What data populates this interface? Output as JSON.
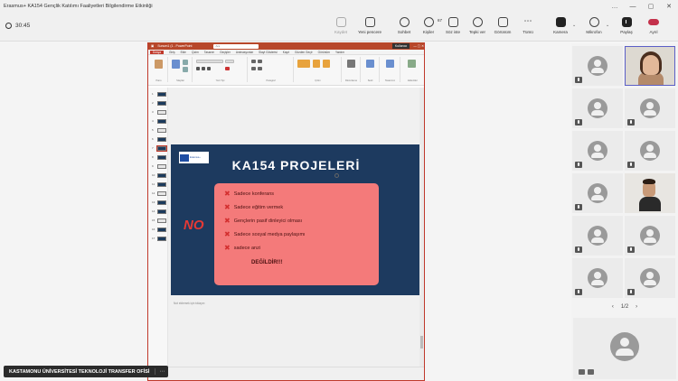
{
  "window": {
    "title": "Erasmus+ KA154 Gençlik Katılımı Faaliyetleri Bilgilendirme Etkinliği",
    "controls": [
      "…",
      "—",
      "▢",
      "✕"
    ]
  },
  "toolbar": {
    "timer": "30:45",
    "buttons": [
      {
        "label": "Kaydet",
        "icon": "save-icon",
        "disabled": true
      },
      {
        "label": "Yeni pencere",
        "icon": "new-window-icon",
        "disabled": false
      },
      {
        "label": "Sohbet",
        "icon": "chat-icon",
        "disabled": false
      },
      {
        "label": "Kişiler",
        "icon": "people-icon",
        "disabled": false,
        "count": "67"
      },
      {
        "label": "Söz iste",
        "icon": "raise-hand-icon",
        "disabled": false
      },
      {
        "label": "Tepki ver",
        "icon": "reaction-icon",
        "disabled": false
      },
      {
        "label": "Görünüm",
        "icon": "view-icon",
        "disabled": false
      },
      {
        "label": "Tümü",
        "icon": "more-icon",
        "disabled": false
      },
      {
        "label": "Kamera",
        "icon": "camera-icon",
        "disabled": false
      },
      {
        "label": "Mikrofon",
        "icon": "microphone-icon",
        "disabled": false
      },
      {
        "label": "Paylaş",
        "icon": "share-icon",
        "disabled": false
      }
    ],
    "leave_label": "Ayrıl"
  },
  "ppt": {
    "title": "Sunum1 (1 - PowerPoint",
    "search_placeholder": "Ara",
    "user": "Kullanıcı",
    "menu": [
      "Dosya",
      "Giriş",
      "Ekle",
      "Çizim",
      "Tasarım",
      "Geçişler",
      "Animasyonlar",
      "Slayt Gösterisi",
      "Kayıt",
      "Gözden Geçir",
      "Görünüm",
      "Yardım"
    ],
    "ribbon_groups": [
      "Pano",
      "Slaytlar",
      "Yazı Tipi",
      "Paragraf",
      "Çizim",
      "Düzenleme",
      "Sesli",
      "Tasarımcı",
      "Eklentiler"
    ],
    "slide_numbers": [
      "1",
      "2",
      "3",
      "4",
      "5",
      "6",
      "7",
      "8",
      "9",
      "10",
      "11",
      "12",
      "13",
      "14",
      "15",
      "16",
      "17"
    ],
    "notes_placeholder": "Not eklemek için tıklayın",
    "slide": {
      "logo_text": "Erasmus+",
      "title": "KA154 PROJELERİ",
      "side_text": "NO",
      "bullets": [
        "Sadece konferans",
        "Sadece eğitim vermek",
        "Gençlerin pasif dinleyici olması",
        "Sadece sosyal medya paylaşımı",
        "sadece anzi"
      ],
      "footer": "DEĞİLDİR!!!"
    }
  },
  "presenter": {
    "name": "KASTAMONU ÜNİVERSİTESİ TEKNOLOJİ TRANSFER OFİSİ",
    "more": "⋯"
  },
  "gallery": {
    "pager": "1/2",
    "prev": "‹",
    "next": "›"
  },
  "colors": {
    "ppt_accent": "#b7472a",
    "slide_bg": "#1d3a5f",
    "pink_box": "#f47a7a",
    "bullet_x": "#d32f2f",
    "leave": "#c4314b",
    "active_speaker": "#5b5fc7"
  }
}
